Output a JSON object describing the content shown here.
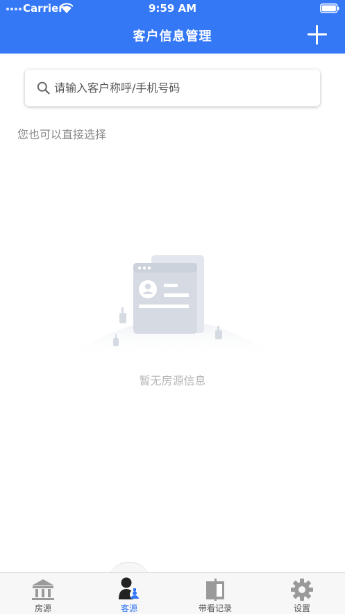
{
  "status_bar": {
    "carrier": "Carrier",
    "time": "9:59 AM"
  },
  "nav": {
    "title": "客户信息管理",
    "add_icon": "plus-icon"
  },
  "search": {
    "placeholder": "请输入客户称呼/手机号码",
    "value": "",
    "icon": "search-icon"
  },
  "hint": "您也可以直接选择",
  "empty_state": {
    "message": "暂无房源信息",
    "icon": "empty-profile-illustration"
  },
  "tabs": [
    {
      "label": "房源",
      "icon": "building-icon",
      "active": false
    },
    {
      "label": "客源",
      "icon": "customer-icon",
      "active": true
    },
    {
      "label": "带看记录",
      "icon": "door-icon",
      "active": false
    },
    {
      "label": "设置",
      "icon": "gear-icon",
      "active": false
    }
  ],
  "colors": {
    "primary": "#3478f6",
    "tab_inactive": "#555555",
    "empty_text": "#b5b5b5",
    "hint_text": "#8a8a8a"
  }
}
